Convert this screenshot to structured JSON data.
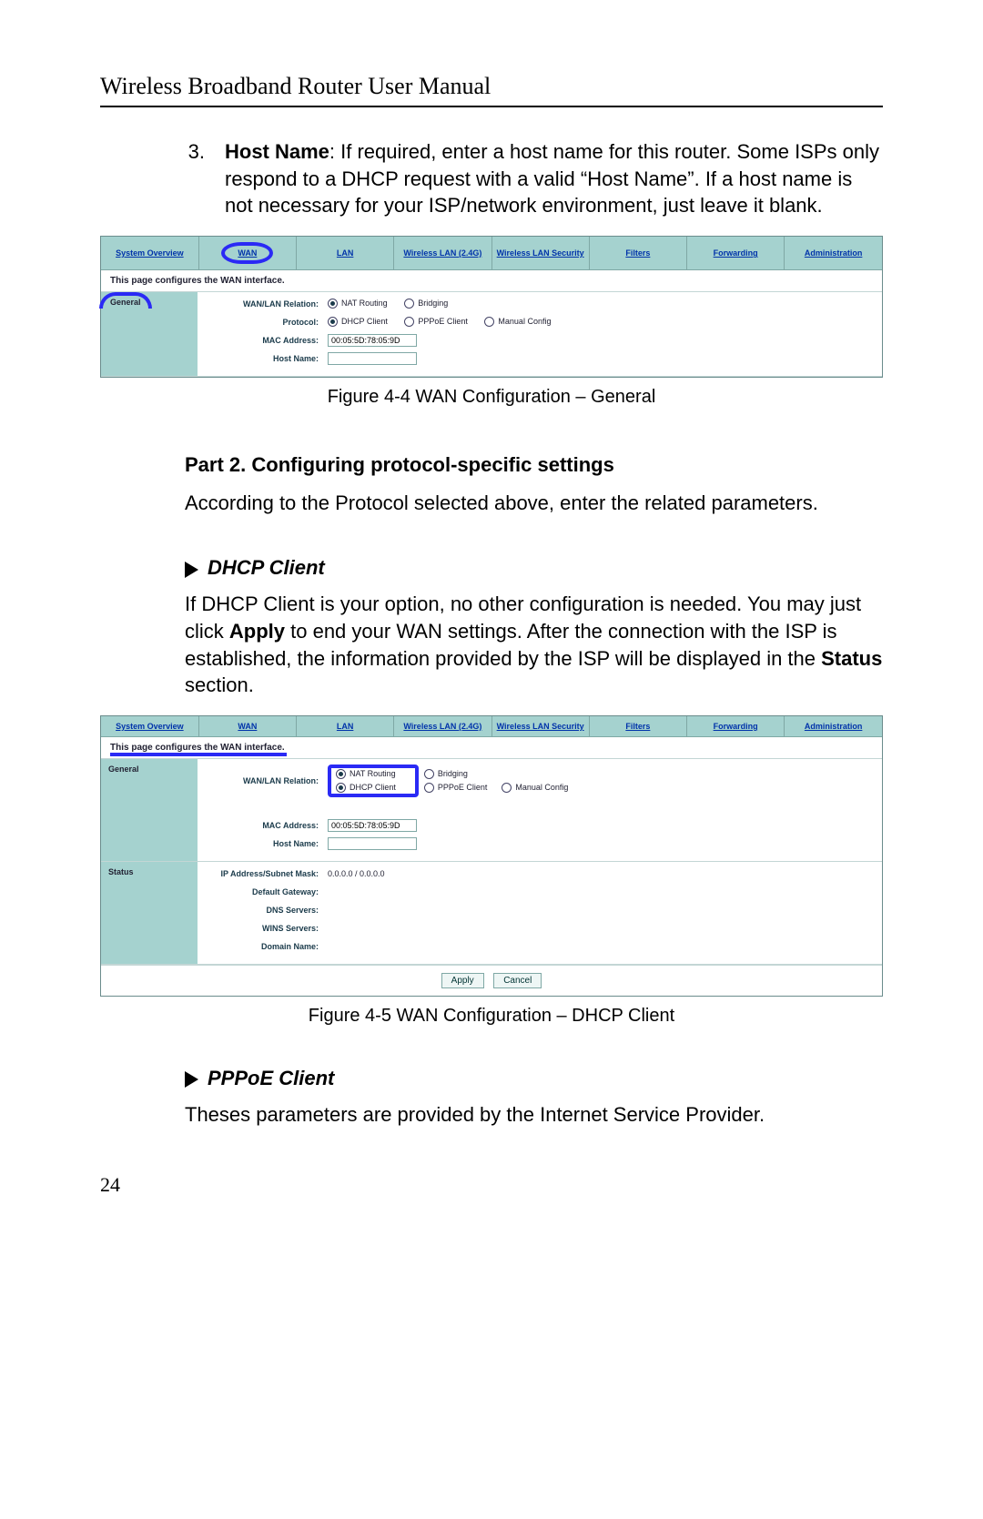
{
  "doc": {
    "title": "Wireless Broadband Router User Manual",
    "page_number": "24",
    "item3_number": "3.",
    "item3_label": "Host Name",
    "item3_text_after": ": If required, enter a host name for this router. Some ISPs only respond to a DHCP request with a valid “Host Name”. If a host name is not necessary for your ISP/network environment, just leave it blank.",
    "figure4_caption": "Figure 4-4  WAN Configuration – General",
    "part2_heading": "Part 2. Configuring protocol-specific settings",
    "part2_body": "According to the Protocol selected above, enter the related parameters.",
    "dhcp_heading": "DHCP Client",
    "dhcp_body_1": "If DHCP Client is your option, no other configuration is needed. You may just click ",
    "dhcp_body_apply": "Apply",
    "dhcp_body_2": " to end your WAN settings. After the connection with the ISP is established, the information provided by the ISP will be displayed in the ",
    "dhcp_body_status": "Status",
    "dhcp_body_3": " section.",
    "figure5_caption": "Figure 4-5  WAN Configuration – DHCP Client",
    "pppoe_heading": "PPPoE Client",
    "pppoe_body": "Theses parameters are provided by the Internet Service Provider."
  },
  "panel": {
    "tabs": {
      "sys": "System Overview",
      "wan": "WAN",
      "lan": "LAN",
      "wlan24": "Wireless LAN (2.4G)",
      "wlansec": "Wireless LAN Security",
      "filters": "Filters",
      "fwd": "Forwarding",
      "admin": "Administration"
    },
    "desc": "This page configures the WAN interface.",
    "general": {
      "label": "General",
      "relation_label": "WAN/LAN Relation:",
      "protocol_label": "Protocol:",
      "mac_label": "MAC Address:",
      "host_label": "Host Name:",
      "nat": "NAT Routing",
      "bridging": "Bridging",
      "dhcp": "DHCP Client",
      "pppoe": "PPPoE Client",
      "manual": "Manual Config",
      "mac_value": "00:05:5D:78:05:9D"
    },
    "status": {
      "label": "Status",
      "ipmask_label": "IP Address/Subnet Mask:",
      "ipmask_value": "0.0.0.0 / 0.0.0.0",
      "gw_label": "Default Gateway:",
      "dns_label": "DNS Servers:",
      "wins_label": "WINS Servers:",
      "domain_label": "Domain Name:"
    },
    "btn_apply": "Apply",
    "btn_cancel": "Cancel"
  }
}
